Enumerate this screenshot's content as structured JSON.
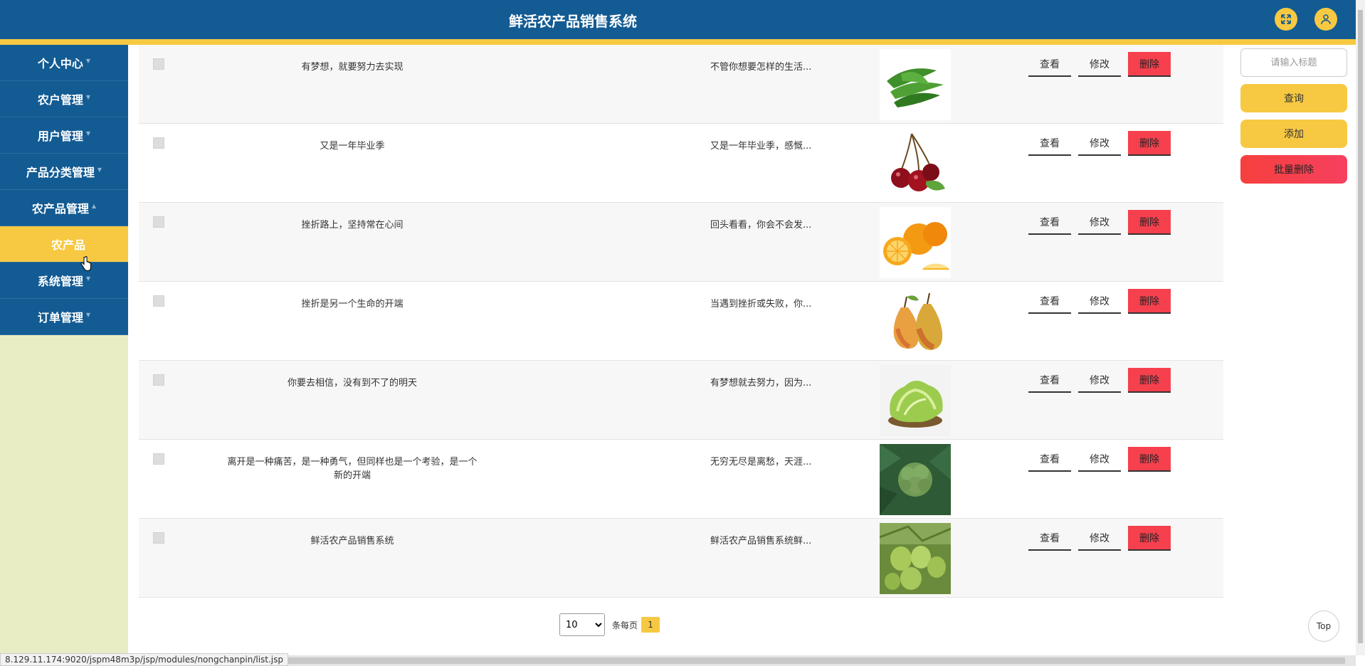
{
  "header": {
    "title": "鲜活农产品销售系统"
  },
  "sidebar": {
    "items": [
      {
        "label": "个人中心"
      },
      {
        "label": "农户管理"
      },
      {
        "label": "用户管理"
      },
      {
        "label": "产品分类管理"
      },
      {
        "label": "农产品管理"
      },
      {
        "label": "农产品"
      },
      {
        "label": "系统管理"
      },
      {
        "label": "订单管理"
      }
    ]
  },
  "table": {
    "rows": [
      {
        "title": "有梦想，就要努力去实现",
        "intro": "不管你想要怎样的生活...",
        "image": "green-beans"
      },
      {
        "title": "又是一年毕业季",
        "intro": "又是一年毕业季，感慨...",
        "image": "cherries"
      },
      {
        "title": "挫折路上，坚持常在心间",
        "intro": "回头看看，你会不会发...",
        "image": "oranges"
      },
      {
        "title": "挫折是另一个生命的开端",
        "intro": "当遇到挫折或失败，你...",
        "image": "pears"
      },
      {
        "title": "你要去相信，没有到不了的明天",
        "intro": "有梦想就去努力，因为...",
        "image": "lettuce"
      },
      {
        "title": "离开是一种痛苦，是一种勇气，但同样也是一个考验，是一个新的开端",
        "intro": "无穷无尽是离愁，天涯...",
        "image": "broccoli"
      },
      {
        "title": "鲜活农产品销售系统",
        "intro": "鲜活农产品销售系统鲜...",
        "image": "green-fruit"
      }
    ],
    "actions": {
      "view": "查看",
      "edit": "修改",
      "delete": "删除"
    }
  },
  "pager": {
    "page_size": "10",
    "per_page_label": "条每页",
    "current_page": "1"
  },
  "right_panel": {
    "search_placeholder": "请输入标题",
    "query": "查询",
    "add": "添加",
    "batch_delete": "批量删除"
  },
  "top_button": "Top",
  "status_url": "8.129.11.174:9020/jspm48m3p/jsp/modules/nongchanpin/list.jsp",
  "colors": {
    "primary": "#135b93",
    "accent": "#f7c942",
    "danger": "#f6404d",
    "sidebar_bg": "#e9edc4"
  }
}
